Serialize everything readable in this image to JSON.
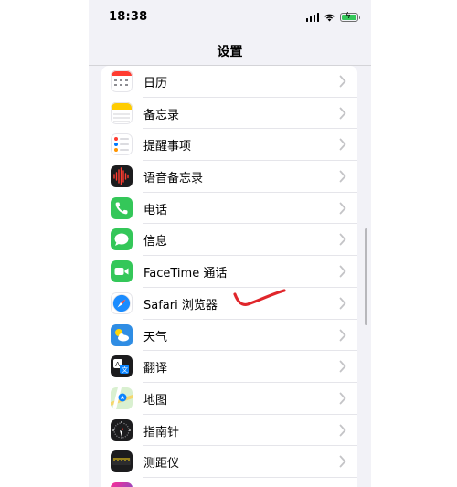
{
  "status_bar": {
    "time": "18:38",
    "icons": [
      "signal-icon",
      "wifi-icon",
      "battery-charging-icon"
    ],
    "battery_color": "#34c759"
  },
  "nav": {
    "title": "设置"
  },
  "settings_items": [
    {
      "label": "日历",
      "icon": "calendar-icon"
    },
    {
      "label": "备忘录",
      "icon": "notes-icon"
    },
    {
      "label": "提醒事项",
      "icon": "reminders-icon"
    },
    {
      "label": "语音备忘录",
      "icon": "voice-memos-icon"
    },
    {
      "label": "电话",
      "icon": "phone-icon"
    },
    {
      "label": "信息",
      "icon": "messages-icon"
    },
    {
      "label": "FaceTime 通话",
      "icon": "facetime-icon"
    },
    {
      "label": "Safari 浏览器",
      "icon": "safari-icon"
    },
    {
      "label": "天气",
      "icon": "weather-icon"
    },
    {
      "label": "翻译",
      "icon": "translate-icon"
    },
    {
      "label": "地图",
      "icon": "maps-icon"
    },
    {
      "label": "指南针",
      "icon": "compass-icon"
    },
    {
      "label": "测距仪",
      "icon": "measure-icon"
    },
    {
      "label": "",
      "icon": "shortcuts-icon"
    }
  ],
  "colors": {
    "background": "#f2f2f7",
    "annotation": "#e0262b",
    "chevron": "#c4c4c7"
  }
}
